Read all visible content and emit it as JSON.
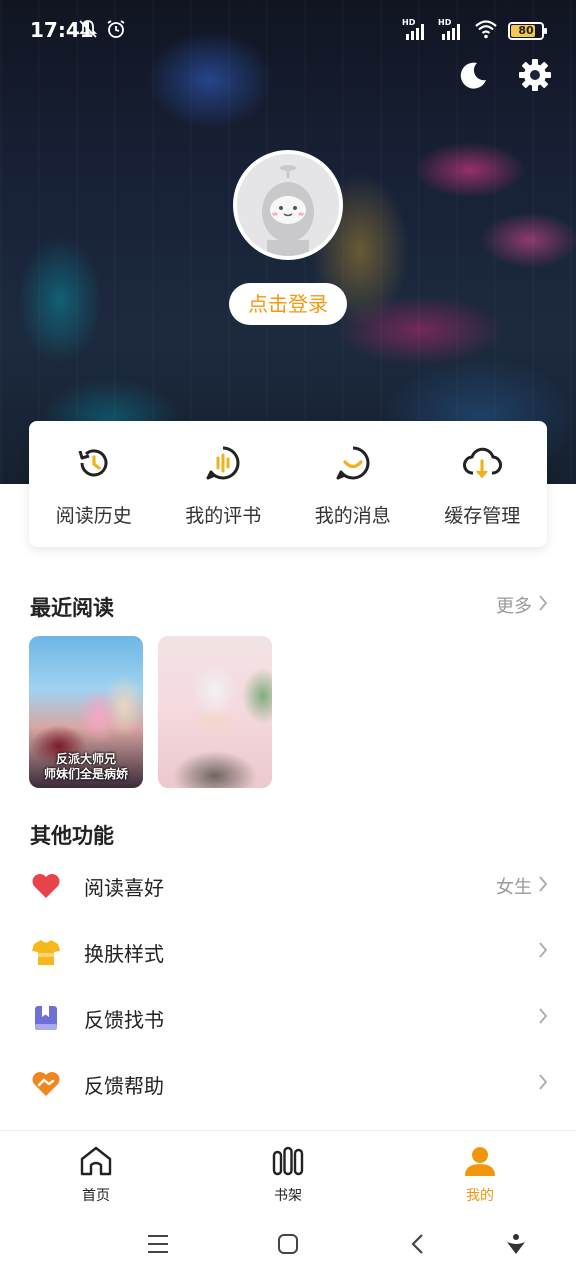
{
  "status": {
    "time": "17:41",
    "battery": "80",
    "battery_level": 0.8,
    "net1": "HD",
    "net2": "HD"
  },
  "header": {
    "login_label": "点击登录"
  },
  "quick": [
    {
      "label": "阅读历史",
      "icon": "history-icon"
    },
    {
      "label": "我的评书",
      "icon": "comment-icon"
    },
    {
      "label": "我的消息",
      "icon": "message-icon"
    },
    {
      "label": "缓存管理",
      "icon": "cloud-download-icon"
    }
  ],
  "recent": {
    "title": "最近阅读",
    "more": "更多",
    "covers": [
      {
        "title_line1": "反派大师兄",
        "title_line2": "师妹们全是病娇"
      },
      {
        "title_line1": "",
        "title_line2": ""
      }
    ]
  },
  "features": {
    "title": "其他功能",
    "items": [
      {
        "label": "阅读喜好",
        "value": "女生",
        "icon": "heart-icon",
        "color": "#e8434b"
      },
      {
        "label": "换肤样式",
        "value": "",
        "icon": "tshirt-icon",
        "color": "#f6b81a"
      },
      {
        "label": "反馈找书",
        "value": "",
        "icon": "book-icon",
        "color": "#6f6fd6"
      },
      {
        "label": "反馈帮助",
        "value": "",
        "icon": "handshake-icon",
        "color": "#f0871c"
      }
    ]
  },
  "tabs": [
    {
      "label": "首页",
      "icon": "home-icon"
    },
    {
      "label": "书架",
      "icon": "bookshelf-icon"
    },
    {
      "label": "我的",
      "icon": "profile-icon"
    }
  ],
  "colors": {
    "accent": "#f0960f",
    "text": "#222222",
    "muted": "#999999"
  }
}
